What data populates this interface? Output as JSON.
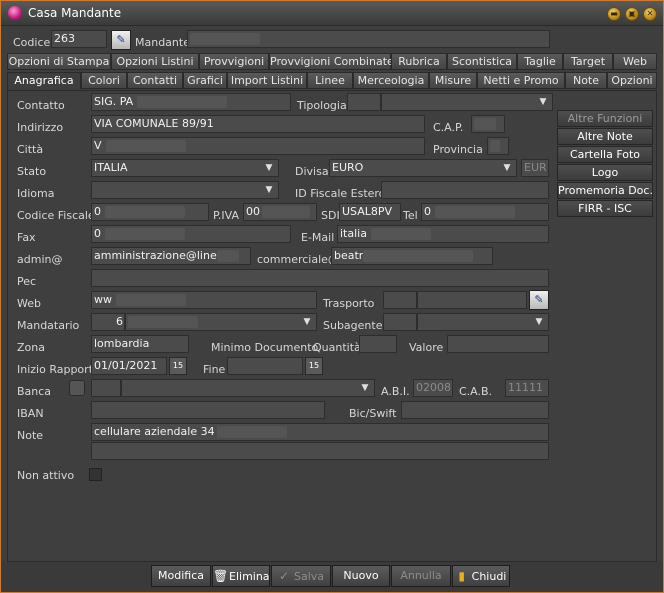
{
  "window": {
    "title": "Casa Mandante",
    "controls": {
      "minimize": "▬",
      "maximize": "▣",
      "close": "✕"
    }
  },
  "header": {
    "codice_label": "Codice",
    "codice_value": "263",
    "mandante_label": "Mandante",
    "mandante_value": ""
  },
  "tabs_row1": [
    "Opzioni di Stampa",
    "Opzioni Listini",
    "Provvigioni",
    "Provvigioni Combinate",
    "Rubrica",
    "Scontistica",
    "Taglie",
    "Target",
    "Web"
  ],
  "tabs_row2": [
    "Anagrafica",
    "Colori",
    "Contatti",
    "Grafici",
    "Import Listini",
    "Linee",
    "Merceologia",
    "Misure",
    "Netti e Promo",
    "Note",
    "Opzioni"
  ],
  "active_tab": "Anagrafica",
  "form": {
    "contatto": {
      "label": "Contatto",
      "value": "SIG. PA"
    },
    "tipologia": {
      "label": "Tipologia",
      "value": ""
    },
    "indirizzo": {
      "label": "Indirizzo",
      "value": "VIA COMUNALE 89/91"
    },
    "cap": {
      "label": "C.A.P.",
      "value": ""
    },
    "citta": {
      "label": "Città",
      "value": "V"
    },
    "provincia": {
      "label": "Provincia",
      "value": ""
    },
    "stato": {
      "label": "Stato",
      "value": "ITALIA"
    },
    "divisa": {
      "label": "Divisa",
      "value": "EURO",
      "code": "EUR"
    },
    "idioma": {
      "label": "Idioma",
      "value": ""
    },
    "id_fiscale_estero": {
      "label": "ID Fiscale Estero",
      "value": ""
    },
    "codice_fiscale": {
      "label": "Codice Fiscale",
      "value": "0"
    },
    "piva": {
      "label": "P.IVA",
      "value": "00"
    },
    "sdi": {
      "label": "SDI",
      "value": "USAL8PV"
    },
    "tel": {
      "label": "Tel",
      "value": "0"
    },
    "fax": {
      "label": "Fax",
      "value": "0"
    },
    "email": {
      "label": "E-Mail",
      "value": "italia"
    },
    "admin": {
      "label": "admin@",
      "value": "amministrazione@line"
    },
    "commerciale": {
      "label": "commerciale@",
      "value": "beatr"
    },
    "pec": {
      "label": "Pec",
      "value": ""
    },
    "web": {
      "label": "Web",
      "value": "ww"
    },
    "trasporto": {
      "label": "Trasporto",
      "value": ""
    },
    "mandatario": {
      "label": "Mandatario",
      "value": "6"
    },
    "subagente": {
      "label": "Subagente",
      "value": ""
    },
    "zona": {
      "label": "Zona",
      "value": "lombardia"
    },
    "minimo_documento": {
      "label": "Minimo Documento"
    },
    "quantita": {
      "label": "Quantità",
      "value": ""
    },
    "valore": {
      "label": "Valore",
      "value": ""
    },
    "inizio_rapporto": {
      "label": "Inizio Rapporto",
      "value": "01/01/2021"
    },
    "fine": {
      "label": "Fine",
      "value": ""
    },
    "banca": {
      "label": "Banca",
      "value": ""
    },
    "abi": {
      "label": "A.B.I.",
      "value": "02008"
    },
    "cab": {
      "label": "C.A.B.",
      "value": "11111"
    },
    "iban": {
      "label": "IBAN",
      "value": ""
    },
    "bic": {
      "label": "Bic/Swift",
      "value": ""
    },
    "note": {
      "label": "Note",
      "value": "cellulare aziendale 34"
    },
    "non_attivo": {
      "label": "Non attivo",
      "checked": false
    },
    "calendar_icon_text": "15"
  },
  "side_buttons": [
    {
      "label": "Altre Funzioni",
      "enabled": false
    },
    {
      "label": "Altre Note",
      "enabled": true
    },
    {
      "label": "Cartella Foto",
      "enabled": true
    },
    {
      "label": "Logo",
      "enabled": true
    },
    {
      "label": "Promemoria  Doc.",
      "enabled": true
    },
    {
      "label": "FIRR - ISC",
      "enabled": true
    }
  ],
  "bottom_buttons": {
    "modifica": "Modifica",
    "elimina": "Elimina",
    "salva": "Salva",
    "nuovo": "Nuovo",
    "annulla": "Annulla",
    "chiudi": "Chiudi"
  },
  "colors": {
    "accent_border": "#d07a2a",
    "background": "#3e3e3e"
  }
}
